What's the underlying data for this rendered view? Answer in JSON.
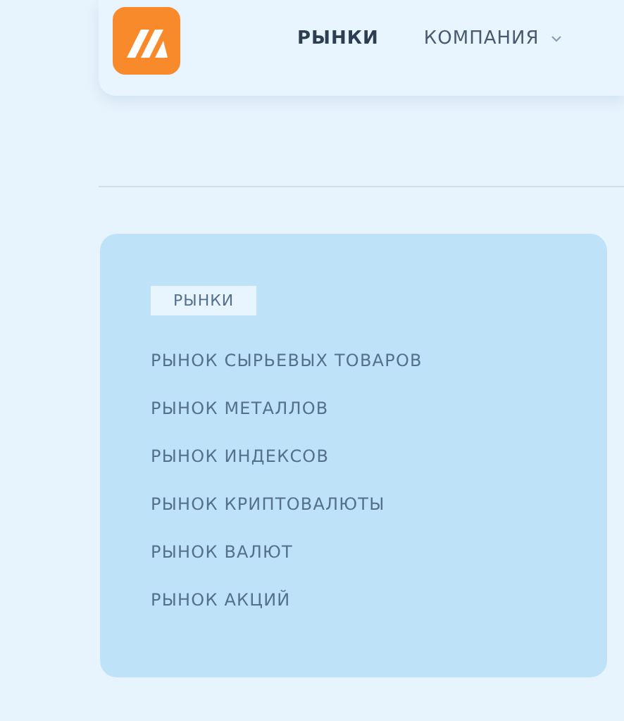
{
  "nav": [
    {
      "label": "РЫНКИ",
      "selected": true,
      "kind": "link"
    },
    {
      "label": "КОМПАНИЯ",
      "selected": false,
      "kind": "dropdown"
    }
  ],
  "panel": {
    "tag": "РЫНКИ",
    "items": [
      "РЫНОК СЫРЬЕВЫХ ТОВАРОВ",
      "РЫНОК МЕТАЛЛОВ",
      "РЫНОК ИНДЕКСОВ",
      "РЫНОК КРИПТОВАЛЮТЫ",
      "РЫНОК ВАЛЮТ",
      "РЫНОК АКЦИЙ"
    ]
  }
}
